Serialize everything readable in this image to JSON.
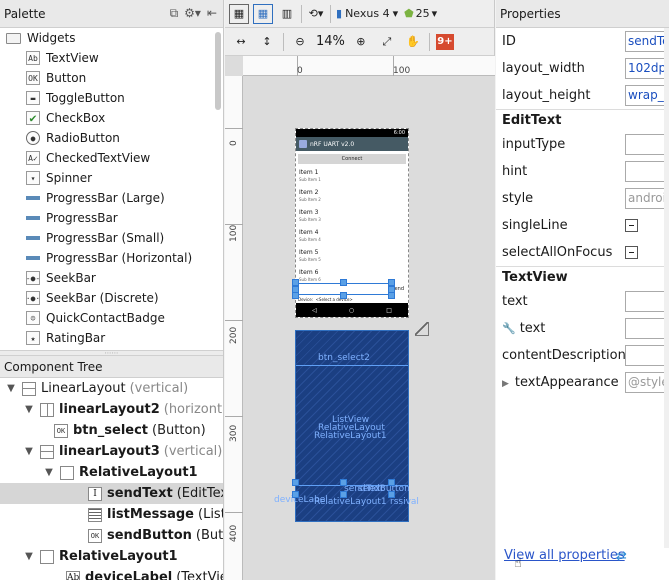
{
  "palette": {
    "title": "Palette",
    "category": "Widgets",
    "items": [
      "TextView",
      "Button",
      "ToggleButton",
      "CheckBox",
      "RadioButton",
      "CheckedTextView",
      "Spinner",
      "ProgressBar (Large)",
      "ProgressBar",
      "ProgressBar (Small)",
      "ProgressBar (Horizontal)",
      "SeekBar",
      "SeekBar (Discrete)",
      "QuickContactBadge",
      "RatingBar"
    ]
  },
  "tree": {
    "title": "Component Tree",
    "rows": [
      {
        "name": "LinearLayout",
        "detail": "(vertical)"
      },
      {
        "name": "linearLayout2",
        "detail": "(horizonta"
      },
      {
        "name": "btn_select",
        "detail": "(Button)"
      },
      {
        "name": "linearLayout3",
        "detail": "(vertical)"
      },
      {
        "name": "RelativeLayout1",
        "detail": ""
      },
      {
        "name": "sendText",
        "detail": "(EditTex"
      },
      {
        "name": "listMessage",
        "detail": "(ListV"
      },
      {
        "name": "sendButton",
        "detail": "(Butto"
      },
      {
        "name": "RelativeLayout1",
        "detail": ""
      },
      {
        "name": "deviceLabel",
        "detail": "(TextVie"
      }
    ]
  },
  "toolbar": {
    "device": "Nexus 4",
    "api": "25",
    "zoom": "14%"
  },
  "ruler": {
    "top": [
      "0",
      "100"
    ],
    "left": [
      "0",
      "100",
      "200",
      "300",
      "400"
    ]
  },
  "phone": {
    "status_time": "6:00",
    "app_title": "nRF UART v2.0",
    "connect_label": "Connect",
    "items": [
      {
        "title": "Item 1",
        "sub": "Sub Item 1"
      },
      {
        "title": "Item 2",
        "sub": "Sub Item 2"
      },
      {
        "title": "Item 3",
        "sub": "Sub Item 3"
      },
      {
        "title": "Item 4",
        "sub": "Sub Item 4"
      },
      {
        "title": "Item 5",
        "sub": "Sub Item 5"
      },
      {
        "title": "Item 6",
        "sub": "Sub Item 6"
      }
    ],
    "send_label": "Send",
    "footer_left": "Device:",
    "footer_right": "<Select a device>"
  },
  "blueprint": {
    "btn_select": "btn_select2",
    "list_view": "ListView",
    "relative_a": "RelativeLayout",
    "relative_b": "RelativeLayout1",
    "send_text": "sendText",
    "send_button": "sendButton",
    "device_label": "deviceLabel",
    "relative_c": "RelativeLayout1",
    "rssival": "rssival"
  },
  "properties": {
    "title": "Properties",
    "top_rows": [
      {
        "name": "ID",
        "value": "sendText"
      },
      {
        "name": "layout_width",
        "value": "102dp"
      },
      {
        "name": "layout_height",
        "value": "wrap_content"
      }
    ],
    "edittext_section": "EditText",
    "edittext_rows": [
      {
        "name": "inputType",
        "value": ""
      },
      {
        "name": "hint",
        "value": ""
      },
      {
        "name": "style",
        "value": "android:attr/editTextStyle"
      }
    ],
    "single_line": "singleLine",
    "select_all": "selectAllOnFocus",
    "textview_section": "TextView",
    "text_row": "text",
    "text_tool_row": "text",
    "content_description": "contentDescription",
    "text_appearance": "textAppearance",
    "text_appearance_value": "@style/TextAppearance.Holo.Light",
    "view_all": "View all properties"
  }
}
